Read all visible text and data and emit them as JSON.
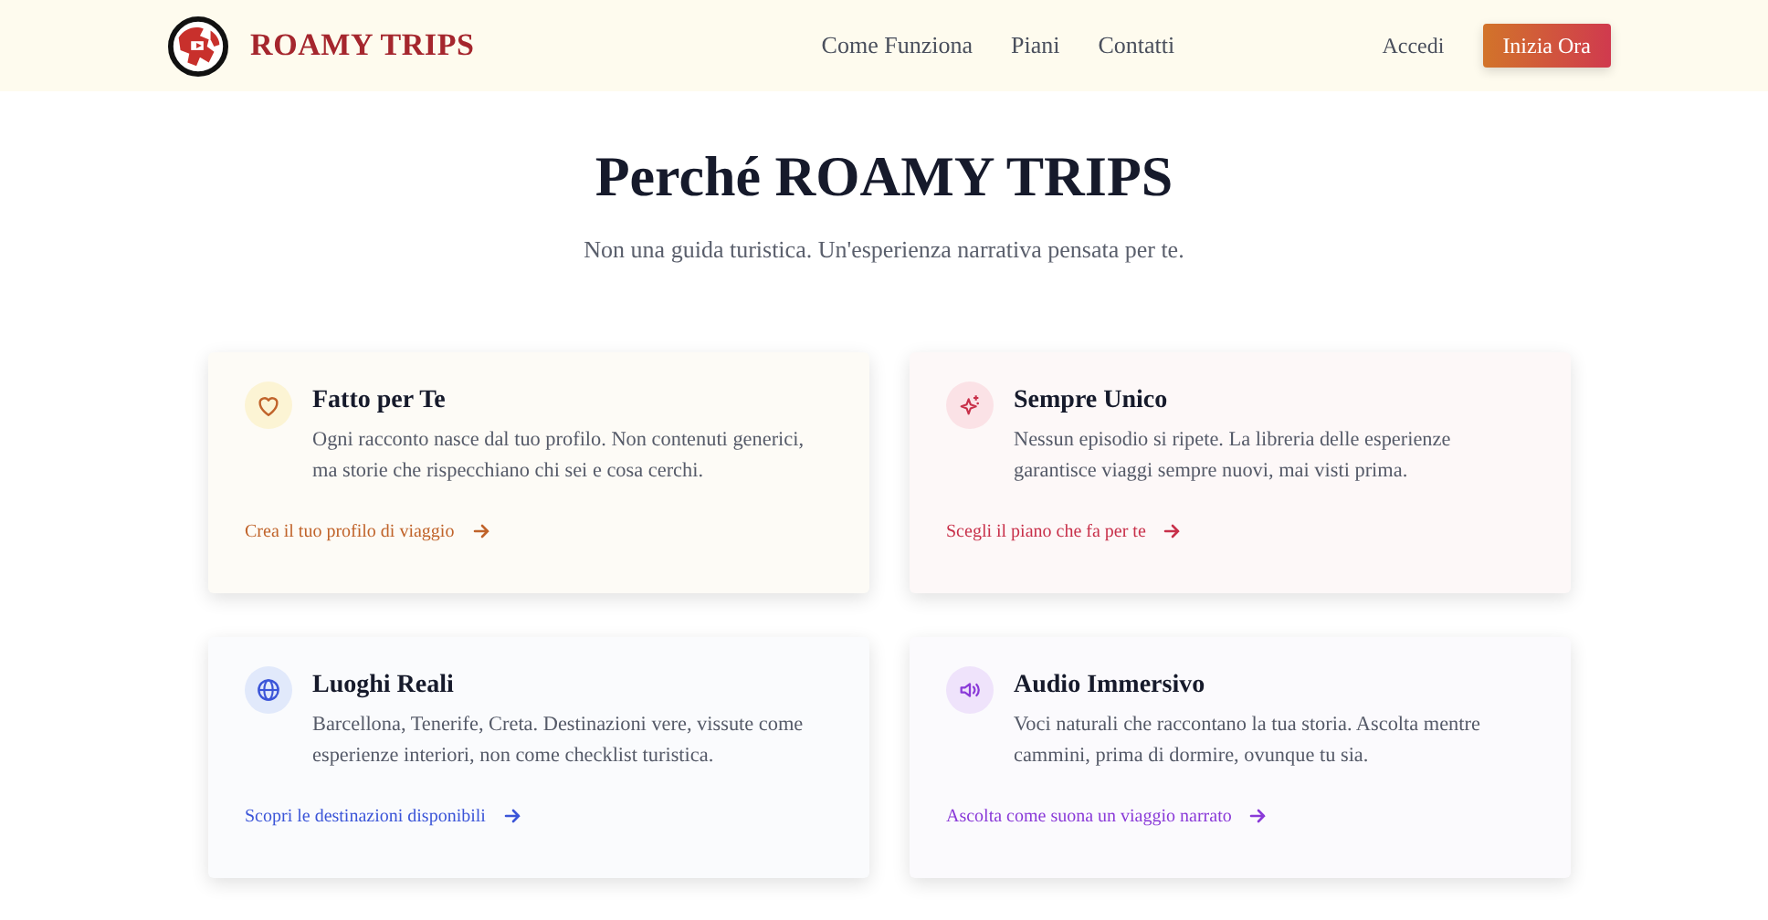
{
  "brand": {
    "name": "ROAMY TRIPS"
  },
  "nav": {
    "links": [
      {
        "label": "Come Funziona"
      },
      {
        "label": "Piani"
      },
      {
        "label": "Contatti"
      }
    ],
    "login": "Accedi",
    "cta": "Inizia Ora"
  },
  "hero": {
    "title": "Perché ROAMY TRIPS",
    "subtitle": "Non una guida turistica. Un'esperienza narrativa pensata per te."
  },
  "features": [
    {
      "kind": "heart",
      "color": "#c0632a",
      "title": "Fatto per Te",
      "text": "Ogni racconto nasce dal tuo profilo. Non contenuti generici, ma storie che rispecchiano chi sei e cosa cerchi.",
      "link": "Crea il tuo profilo di viaggio"
    },
    {
      "kind": "sparkle",
      "color": "#c8304a",
      "title": "Sempre Unico",
      "text": "Nessun episodio si ripete. La libreria delle esperienze garantisce viaggi sempre nuovi, mai visti prima.",
      "link": "Scegli il piano che fa per te"
    },
    {
      "kind": "globe",
      "color": "#3b55d8",
      "title": "Luoghi Reali",
      "text": "Barcellona, Tenerife, Creta. Destinazioni vere, vissute come esperienze interiori, non come checklist turistica.",
      "link": "Scopri le destinazioni disponibili"
    },
    {
      "kind": "speaker",
      "color": "#8a3ad8",
      "title": "Audio Immersivo",
      "text": "Voci naturali che raccontano la tua storia. Ascolta mentre cammini, prima di dormire, ovunque tu sia.",
      "link": "Ascolta come suona un viaggio narrato"
    }
  ]
}
